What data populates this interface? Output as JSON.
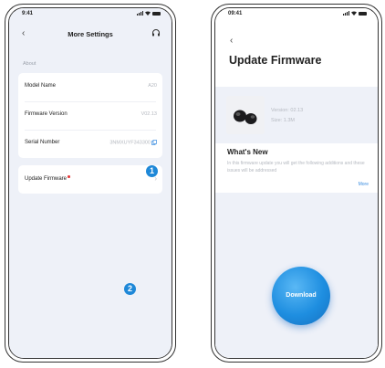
{
  "left_phone": {
    "status_time": "9:41",
    "nav": {
      "back_label": "‹",
      "title": "More Settings"
    },
    "section_label": "About",
    "rows": [
      {
        "label": "Model Name",
        "value": "A20"
      },
      {
        "label": "Firmware Version",
        "value": "V02.13"
      },
      {
        "label": "Serial Number",
        "value": "3NMXUYF343300"
      }
    ],
    "update": {
      "label": "Update Firmware",
      "chevron": "›"
    },
    "step_badge": "1"
  },
  "right_phone": {
    "status_time": "09:41",
    "back_label": "‹",
    "title": "Update Firmware",
    "firmware": {
      "version": "Version: 02.13",
      "size": "Size: 1.3M"
    },
    "whats_new_title": "What's New",
    "notes": "In this firmware update you will get the following additions and these issues will be addressed",
    "more_label": "More",
    "download_label": "Download",
    "step_badge": "2"
  },
  "colors": {
    "accent": "#1e88d8",
    "screen_bg": "#eef1f8",
    "notification_dot": "#e53b3b"
  }
}
